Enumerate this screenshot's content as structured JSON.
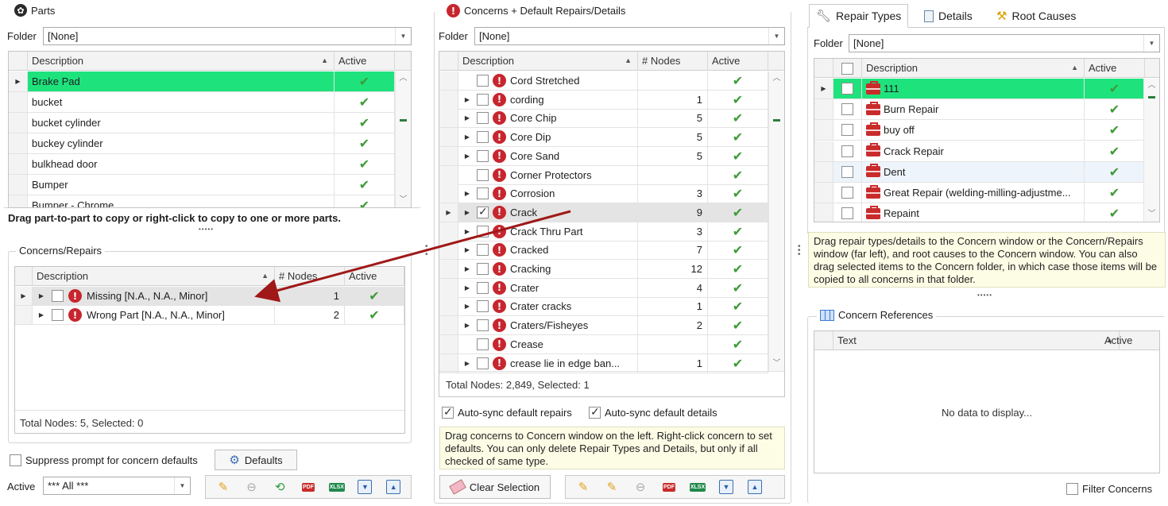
{
  "parts": {
    "title": "Parts",
    "folder_label": "Folder",
    "folder_value": "[None]",
    "col_description": "Description",
    "col_active": "Active",
    "rows": [
      {
        "description": "Brake Pad",
        "active": true
      },
      {
        "description": "bucket",
        "active": true
      },
      {
        "description": "bucket cylinder",
        "active": true
      },
      {
        "description": "buckey cylinder",
        "active": true
      },
      {
        "description": "bulkhead door",
        "active": true
      },
      {
        "description": "Bumper",
        "active": true
      },
      {
        "description": "Bumper - Chrome",
        "active": true
      }
    ],
    "hint": "Drag part-to-part to copy or right-click to copy to one or more parts."
  },
  "concerns_repairs": {
    "title": "Concerns/Repairs",
    "col_description": "Description",
    "col_nodes": "# Nodes",
    "col_active": "Active",
    "rows": [
      {
        "description": "Missing [N.A., N.A., Minor]",
        "nodes": "1",
        "active": true
      },
      {
        "description": "Wrong Part [N.A., N.A., Minor]",
        "nodes": "2",
        "active": true
      }
    ],
    "status": "Total Nodes: 5, Selected: 0",
    "suppress_label": "Suppress prompt for concern defaults",
    "defaults_label": "Defaults",
    "active_label": "Active",
    "active_value": "*** All ***"
  },
  "concerns": {
    "title": "Concerns + Default Repairs/Details",
    "folder_label": "Folder",
    "folder_value": "[None]",
    "col_description": "Description",
    "col_nodes": "# Nodes",
    "col_active": "Active",
    "rows": [
      {
        "description": "Cord Stretched",
        "nodes": "",
        "expand": false,
        "checked": false
      },
      {
        "description": "cording",
        "nodes": "1",
        "expand": true,
        "checked": false
      },
      {
        "description": "Core Chip",
        "nodes": "5",
        "expand": true,
        "checked": false
      },
      {
        "description": "Core Dip",
        "nodes": "5",
        "expand": true,
        "checked": false
      },
      {
        "description": "Core Sand",
        "nodes": "5",
        "expand": true,
        "checked": false
      },
      {
        "description": "Corner Protectors",
        "nodes": "",
        "expand": false,
        "checked": false
      },
      {
        "description": "Corrosion",
        "nodes": "3",
        "expand": true,
        "checked": false
      },
      {
        "description": "Crack",
        "nodes": "9",
        "expand": true,
        "checked": true
      },
      {
        "description": "Crack Thru Part",
        "nodes": "3",
        "expand": true,
        "checked": false
      },
      {
        "description": "Cracked",
        "nodes": "7",
        "expand": true,
        "checked": false
      },
      {
        "description": "Cracking",
        "nodes": "12",
        "expand": true,
        "checked": false
      },
      {
        "description": "Crater",
        "nodes": "4",
        "expand": true,
        "checked": false
      },
      {
        "description": "Crater cracks",
        "nodes": "1",
        "expand": true,
        "checked": false
      },
      {
        "description": "Craters/Fisheyes",
        "nodes": "2",
        "expand": true,
        "checked": false
      },
      {
        "description": "Crease",
        "nodes": "",
        "expand": false,
        "checked": false
      },
      {
        "description": "crease lie in edge ban...",
        "nodes": "1",
        "expand": true,
        "checked": false
      }
    ],
    "status": "Total Nodes: 2,849, Selected: 1",
    "autosync_repairs": "Auto-sync default repairs",
    "autosync_details": "Auto-sync default details",
    "note": "Drag concerns to Concern window on the left. Right-click concern to set defaults. You can only delete Repair Types and Details, but only if all checked of same type.",
    "clear_selection": "Clear Selection"
  },
  "repair_types": {
    "tabs": [
      "Repair Types",
      "Details",
      "Root Causes"
    ],
    "folder_label": "Folder",
    "folder_value": "[None]",
    "col_description": "Description",
    "col_active": "Active",
    "rows": [
      {
        "description": "111",
        "active": true
      },
      {
        "description": "Burn Repair",
        "active": true
      },
      {
        "description": "buy off",
        "active": true
      },
      {
        "description": "Crack Repair",
        "active": true
      },
      {
        "description": "Dent",
        "active": true
      },
      {
        "description": "Great Repair (welding-milling-adjustme...",
        "active": true
      },
      {
        "description": "Repaint",
        "active": true
      }
    ],
    "note": "Drag repair types/details to the Concern window or the Concern/Repairs window (far left), and root causes to the Concern window. You can also drag selected items to the Concern folder, in which case those items will be copied to all concerns in that folder."
  },
  "concern_references": {
    "title": "Concern References",
    "col_text": "Text",
    "col_active": "Active",
    "empty": "No data to display...",
    "filter_label": "Filter Concerns"
  },
  "icons": {
    "check": "✔",
    "error": "!",
    "grip": "•••••"
  },
  "colors": {
    "selected_row": "#1ee37d",
    "accent_red": "#c7262e",
    "check_green": "#3e9b37"
  }
}
